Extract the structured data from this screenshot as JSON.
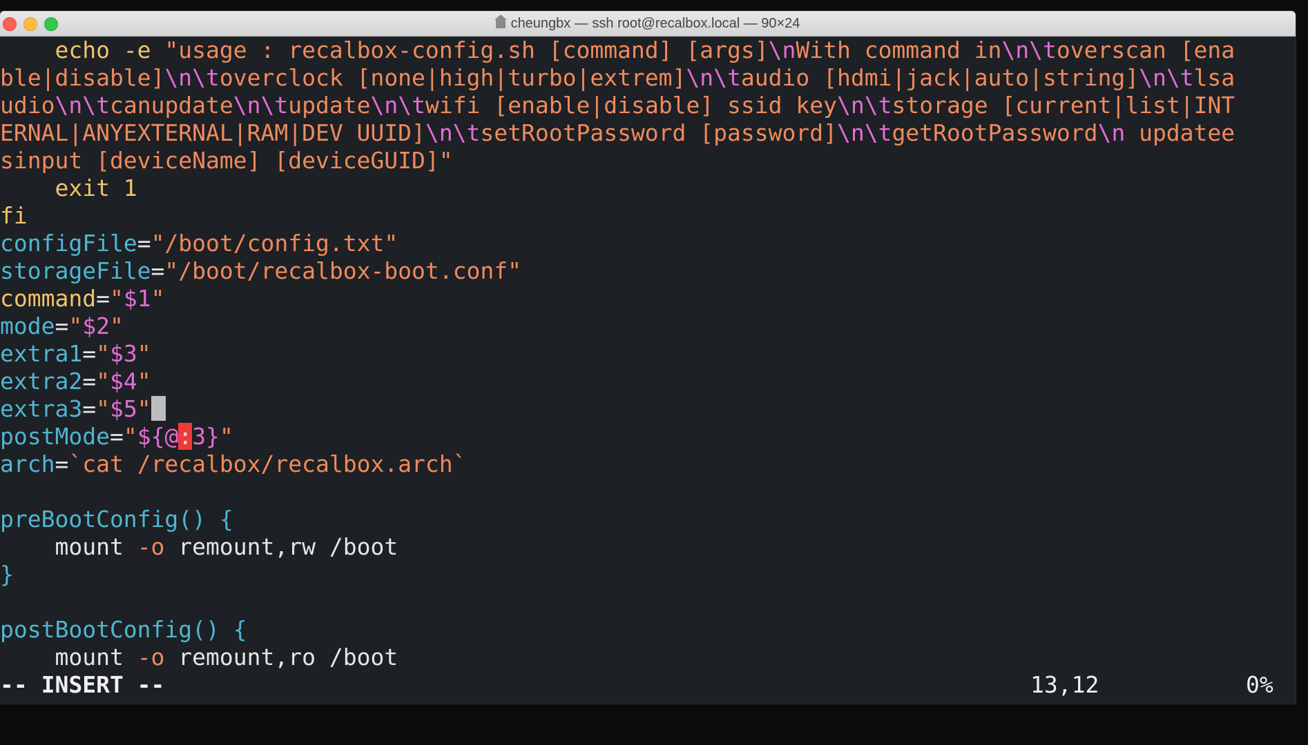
{
  "window": {
    "title": "cheungbx — ssh root@recalbox.local — 90×24"
  },
  "colors": {
    "orange": "#f08a5d",
    "magenta": "#e46dd6",
    "cyan": "#4fb6d3",
    "gold": "#f2c36b",
    "white": "#e6e6e6",
    "cursor_red": "#ee3a3a"
  },
  "editor": {
    "lines": [
      [
        {
          "t": "    echo -e ",
          "c": "gold"
        },
        {
          "t": "\"usage : recalbox-config.sh [command] [args]",
          "c": "orange"
        },
        {
          "t": "\\n",
          "c": "magenta"
        },
        {
          "t": "With command in",
          "c": "orange"
        },
        {
          "t": "\\n\\t",
          "c": "magenta"
        },
        {
          "t": "overscan [ena",
          "c": "orange"
        }
      ],
      [
        {
          "t": "ble|disable]",
          "c": "orange"
        },
        {
          "t": "\\n\\t",
          "c": "magenta"
        },
        {
          "t": "overclock [none|high|turbo|extrem]",
          "c": "orange"
        },
        {
          "t": "\\n\\t",
          "c": "magenta"
        },
        {
          "t": "audio [hdmi|jack|auto|string]",
          "c": "orange"
        },
        {
          "t": "\\n\\t",
          "c": "magenta"
        },
        {
          "t": "lsa",
          "c": "orange"
        }
      ],
      [
        {
          "t": "udio",
          "c": "orange"
        },
        {
          "t": "\\n\\t",
          "c": "magenta"
        },
        {
          "t": "canupdate",
          "c": "orange"
        },
        {
          "t": "\\n\\t",
          "c": "magenta"
        },
        {
          "t": "update",
          "c": "orange"
        },
        {
          "t": "\\n\\t",
          "c": "magenta"
        },
        {
          "t": "wifi [enable|disable] ssid key",
          "c": "orange"
        },
        {
          "t": "\\n\\t",
          "c": "magenta"
        },
        {
          "t": "storage [current|list|INT",
          "c": "orange"
        }
      ],
      [
        {
          "t": "ERNAL|ANYEXTERNAL|RAM|DEV UUID]",
          "c": "orange"
        },
        {
          "t": "\\n\\t",
          "c": "magenta"
        },
        {
          "t": "setRootPassword [password]",
          "c": "orange"
        },
        {
          "t": "\\n\\t",
          "c": "magenta"
        },
        {
          "t": "getRootPassword",
          "c": "orange"
        },
        {
          "t": "\\n",
          "c": "magenta"
        },
        {
          "t": " updatee",
          "c": "orange"
        }
      ],
      [
        {
          "t": "sinput [deviceName] [deviceGUID]\"",
          "c": "orange"
        }
      ],
      [
        {
          "t": "    exit 1",
          "c": "gold"
        }
      ],
      [
        {
          "t": "fi",
          "c": "gold"
        }
      ],
      [
        {
          "t": "configFile",
          "c": "cyan"
        },
        {
          "t": "=",
          "c": "white"
        },
        {
          "t": "\"/boot/config.txt\"",
          "c": "orange"
        }
      ],
      [
        {
          "t": "storageFile",
          "c": "cyan"
        },
        {
          "t": "=",
          "c": "white"
        },
        {
          "t": "\"/boot/recalbox-boot.conf\"",
          "c": "orange"
        }
      ],
      [
        {
          "t": "command",
          "c": "gold"
        },
        {
          "t": "=",
          "c": "white"
        },
        {
          "t": "\"",
          "c": "orange"
        },
        {
          "t": "$1",
          "c": "magenta"
        },
        {
          "t": "\"",
          "c": "orange"
        }
      ],
      [
        {
          "t": "mode",
          "c": "cyan"
        },
        {
          "t": "=",
          "c": "white"
        },
        {
          "t": "\"",
          "c": "orange"
        },
        {
          "t": "$2",
          "c": "magenta"
        },
        {
          "t": "\"",
          "c": "orange"
        }
      ],
      [
        {
          "t": "extra1",
          "c": "cyan"
        },
        {
          "t": "=",
          "c": "white"
        },
        {
          "t": "\"",
          "c": "orange"
        },
        {
          "t": "$3",
          "c": "magenta"
        },
        {
          "t": "\"",
          "c": "orange"
        }
      ],
      [
        {
          "t": "extra2",
          "c": "cyan"
        },
        {
          "t": "=",
          "c": "white"
        },
        {
          "t": "\"",
          "c": "orange"
        },
        {
          "t": "$4",
          "c": "magenta"
        },
        {
          "t": "\"",
          "c": "orange"
        }
      ],
      [
        {
          "t": "extra3",
          "c": "cyan"
        },
        {
          "t": "=",
          "c": "white"
        },
        {
          "t": "\"",
          "c": "orange"
        },
        {
          "t": "$5",
          "c": "magenta"
        },
        {
          "t": "\"",
          "c": "orange"
        },
        {
          "cursor": true
        }
      ],
      [
        {
          "t": "postMode",
          "c": "cyan"
        },
        {
          "t": "=",
          "c": "white"
        },
        {
          "t": "\"",
          "c": "orange"
        },
        {
          "t": "${@",
          "c": "magenta"
        },
        {
          "t": ":",
          "c": "white",
          "bg": "cursor_red"
        },
        {
          "t": "3}",
          "c": "magenta"
        },
        {
          "t": "\"",
          "c": "orange"
        }
      ],
      [
        {
          "t": "arch",
          "c": "cyan"
        },
        {
          "t": "=",
          "c": "white"
        },
        {
          "t": "`cat /recalbox/recalbox.arch`",
          "c": "orange"
        }
      ],
      [],
      [
        {
          "t": "preBootConfig() {",
          "c": "cyan"
        }
      ],
      [
        {
          "t": "    mount ",
          "c": "white"
        },
        {
          "t": "-o",
          "c": "orange"
        },
        {
          "t": " remount,rw /boot",
          "c": "white"
        }
      ],
      [
        {
          "t": "}",
          "c": "cyan"
        }
      ],
      [],
      [
        {
          "t": "postBootConfig() {",
          "c": "cyan"
        }
      ],
      [
        {
          "t": "    mount ",
          "c": "white"
        },
        {
          "t": "-o",
          "c": "orange"
        },
        {
          "t": " remount,ro /boot",
          "c": "white"
        }
      ]
    ]
  },
  "status": {
    "mode": "-- INSERT --",
    "position": "13,12",
    "percent": "0%"
  }
}
